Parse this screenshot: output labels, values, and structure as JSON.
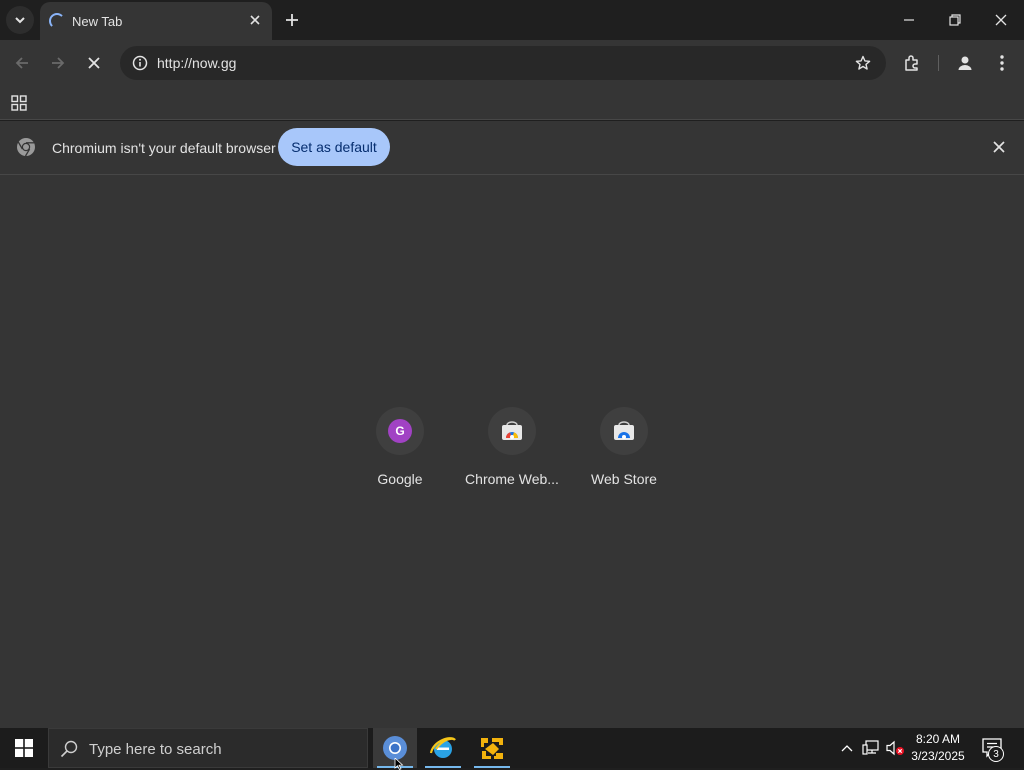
{
  "tabstrip": {
    "tab_title": "New Tab",
    "icons": [
      "chevron-down-icon",
      "spinner-icon",
      "close-icon",
      "plus-icon",
      "minimize-icon",
      "restore-icon",
      "close-window-icon"
    ]
  },
  "toolbar": {
    "url": "http://now.gg",
    "icons": [
      "back-arrow-icon",
      "forward-arrow-icon",
      "stop-loading-icon",
      "site-info-icon",
      "star-icon",
      "extensions-icon",
      "profile-icon",
      "menu-dots-icon"
    ]
  },
  "bookmarks": {
    "icons": [
      "apps-grid-icon"
    ]
  },
  "infobar": {
    "message": "Chromium isn't your default browser",
    "button_label": "Set as default"
  },
  "shortcuts": [
    {
      "label": "Google",
      "icon_letter": "G"
    },
    {
      "label": "Chrome Web...",
      "icon": "chrome-web-store-icon"
    },
    {
      "label": "Web Store",
      "icon": "web-store-icon"
    }
  ],
  "taskbar": {
    "search_placeholder": "Type here to search",
    "time": "8:20 AM",
    "date": "3/23/2025",
    "notification_count": "3",
    "apps": [
      "chromium-icon",
      "ie-icon",
      "app-icon"
    ]
  },
  "colors": {
    "accent": "#a8c7fa",
    "background": "#353535",
    "tab_strip": "#1f1f1f",
    "google_badge": "#a142c4"
  }
}
